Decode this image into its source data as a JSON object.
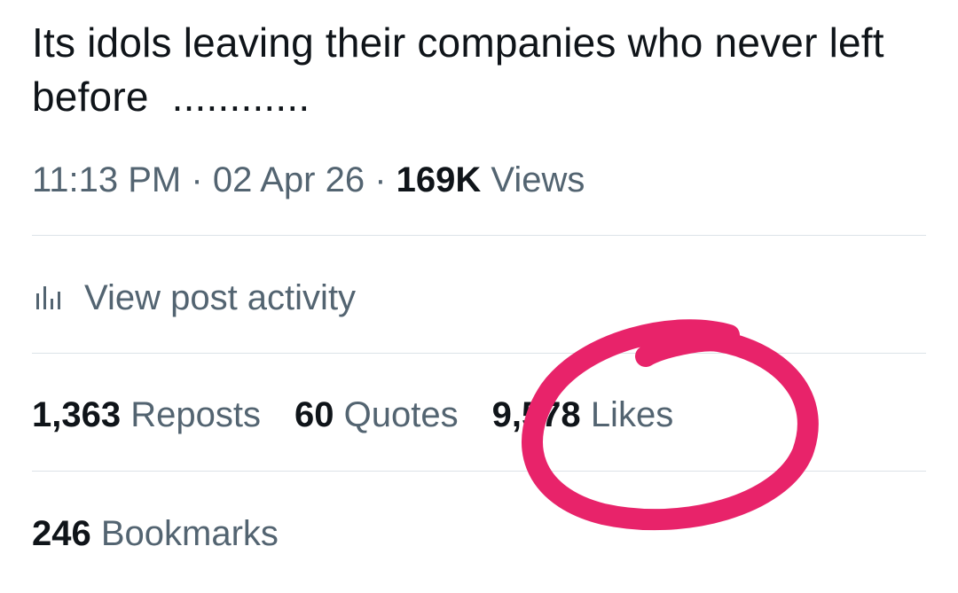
{
  "post": {
    "text": "Its idols leaving their companies who never left before  ............",
    "time": "11:13 PM",
    "date": "02 Apr 26",
    "views_count": "169K",
    "views_label": "Views",
    "separator": "·"
  },
  "activity": {
    "icon": "bar-chart-icon",
    "label": "View post activity"
  },
  "stats": {
    "reposts": {
      "count": "1,363",
      "label": "Reposts"
    },
    "quotes": {
      "count": "60",
      "label": "Quotes"
    },
    "likes": {
      "count": "9,578",
      "label": "Likes"
    },
    "bookmarks": {
      "count": "246",
      "label": "Bookmarks"
    }
  },
  "annotation": {
    "type": "hand-drawn circle",
    "color": "#e8236a"
  },
  "colors": {
    "text_primary": "#0f1419",
    "text_secondary": "#536471",
    "divider": "#dce3e8"
  }
}
